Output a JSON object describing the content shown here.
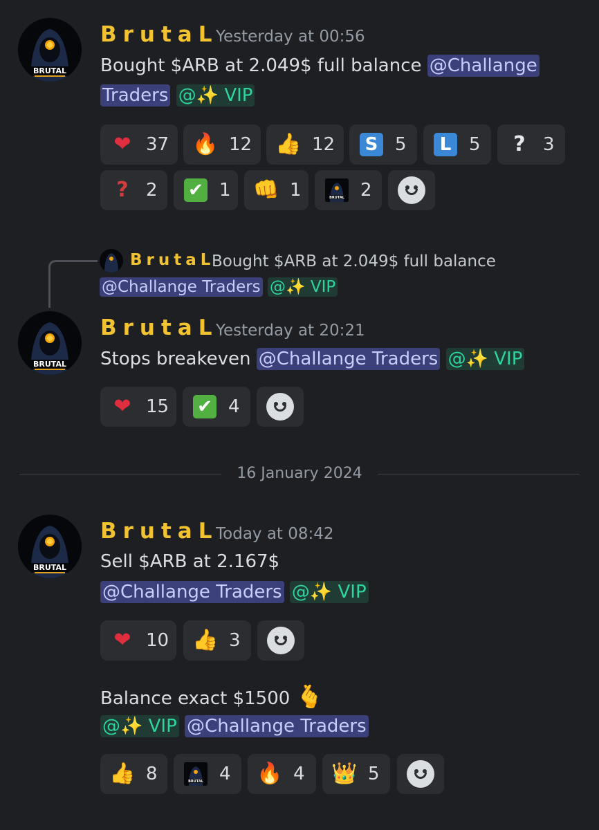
{
  "messages": [
    {
      "author": "BrutaL",
      "timestamp": "Yesterday at 00:56",
      "text": "Bought $ARB at 2.049$ full balance ",
      "mention_role_1": "@Challange",
      "mention_role_1b": "Traders",
      "mention_vip": "@✨ VIP",
      "reactions": [
        {
          "emoji": "heart",
          "glyph": "❤️",
          "count": "37"
        },
        {
          "emoji": "fire",
          "glyph": "🔥",
          "count": "12"
        },
        {
          "emoji": "thumbs-up",
          "glyph": "👍",
          "count": "12"
        },
        {
          "emoji": "letter-s",
          "glyph": "S",
          "count": "5"
        },
        {
          "emoji": "letter-l",
          "glyph": "L",
          "count": "5"
        },
        {
          "emoji": "white-question",
          "glyph": "?",
          "count": "3"
        },
        {
          "emoji": "red-question",
          "glyph": "?",
          "count": "2"
        },
        {
          "emoji": "check",
          "glyph": "✔",
          "count": "1"
        },
        {
          "emoji": "fist",
          "glyph": "👊",
          "count": "1"
        },
        {
          "emoji": "brutal-avatar",
          "glyph": "",
          "count": "2"
        }
      ]
    },
    {
      "reply": {
        "author": "BrutaL",
        "text": "Bought $ARB at 2.049$ full balance",
        "mention_role": "@Challange Traders",
        "mention_vip": "@✨ VIP"
      },
      "author": "BrutaL",
      "timestamp": "Yesterday at 20:21",
      "text": "Stops breakeven ",
      "mention_role": "@Challange Traders",
      "mention_vip": "@✨ VIP",
      "reactions": [
        {
          "emoji": "heart",
          "glyph": "❤️",
          "count": "15"
        },
        {
          "emoji": "check",
          "glyph": "✔",
          "count": "4"
        }
      ]
    },
    {
      "author": "BrutaL",
      "timestamp": "Today at 08:42",
      "text": "Sell $ARB at 2.167$",
      "mention_role": "@Challange Traders",
      "mention_vip": "@✨ VIP",
      "reactions": [
        {
          "emoji": "heart",
          "glyph": "❤️",
          "count": "10"
        },
        {
          "emoji": "thumbs-up",
          "glyph": "👍",
          "count": "3"
        }
      ]
    },
    {
      "text": "Balance exact $1500 ",
      "text_emoji": "🫰",
      "mention_vip": "@✨ VIP",
      "mention_role": "@Challange Traders",
      "reactions": [
        {
          "emoji": "thumbs-up",
          "glyph": "👍",
          "count": "8"
        },
        {
          "emoji": "brutal-avatar",
          "glyph": "",
          "count": "4"
        },
        {
          "emoji": "fire",
          "glyph": "🔥",
          "count": "4"
        },
        {
          "emoji": "crown",
          "glyph": "👑",
          "count": "5"
        }
      ]
    }
  ],
  "date_divider": "16 January 2024",
  "avatar_text": "BRUTAL",
  "colors": {
    "username": "#f1c232",
    "mention_bg": "#3b3f7a",
    "vip_text": "#2fd5a0",
    "background": "#1e1f22",
    "reaction_bg": "#2b2d31"
  }
}
